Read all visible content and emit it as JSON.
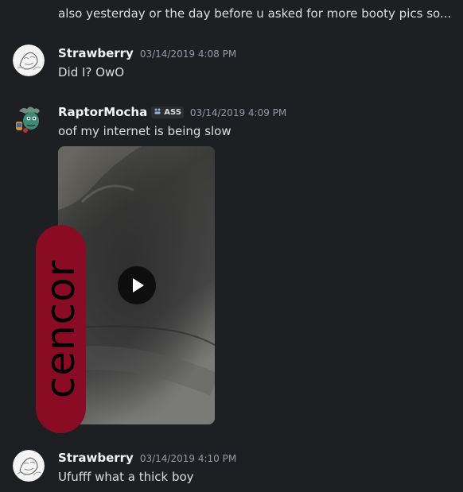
{
  "theme": {
    "background": "#1e1f22",
    "text": "#dbdee1",
    "username": "#f2f3f5",
    "timestamp": "#949ba4",
    "censor": "#8a0c24"
  },
  "messages": [
    {
      "continued_text": "also yesterday or the day before u asked for more booty pics so..."
    },
    {
      "author": "Strawberry",
      "timestamp": "03/14/2019 4:08 PM",
      "text": "Did I? OwO",
      "avatar_icon": "sketch-avatar-icon"
    },
    {
      "author": "RaptorMocha",
      "tag": "ASS",
      "tag_icon": "server-tag-icon",
      "timestamp": "03/14/2019 4:09 PM",
      "text": "oof my internet is being slow",
      "avatar_icon": "goblin-avatar-icon",
      "attachment": {
        "type": "video",
        "play_icon": "play-icon",
        "overlay_text": "cencor"
      }
    },
    {
      "author": "Strawberry",
      "timestamp": "03/14/2019 4:10 PM",
      "text": "Ufufff what a thick boy",
      "avatar_icon": "sketch-avatar-icon"
    }
  ]
}
